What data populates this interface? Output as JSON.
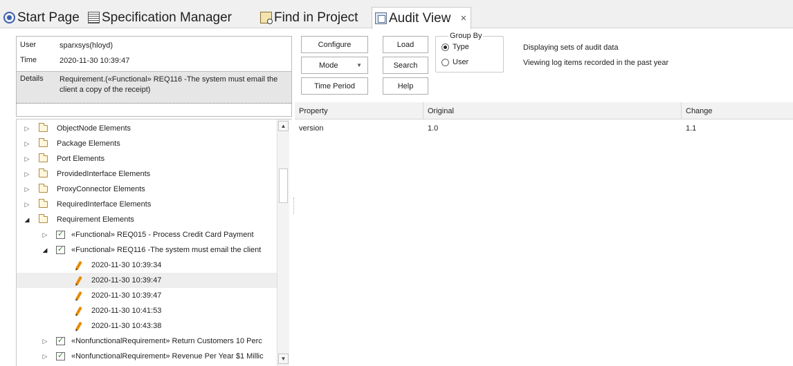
{
  "tabs": [
    {
      "label": "Start Page",
      "icon": "start-page-icon"
    },
    {
      "label": "Specification Manager",
      "icon": "specification-icon"
    },
    {
      "label": "Find in Project",
      "icon": "find-icon"
    },
    {
      "label": "Audit View",
      "icon": "audit-view-icon",
      "active": true,
      "close": "×"
    }
  ],
  "info": {
    "user_label": "User",
    "user_value": "sparxsys(hloyd)",
    "time_label": "Time",
    "time_value": "2020-11-30 10:39:47",
    "details_label": "Details",
    "details_value": "Requirement.(«Functional» REQ116 -The system must email the client a copy of the receipt)"
  },
  "tree": {
    "items": [
      {
        "label": "ObjectNode Elements",
        "expander": "▷",
        "icon": "folder-icon"
      },
      {
        "label": "Package Elements",
        "expander": "▷",
        "icon": "folder-icon"
      },
      {
        "label": "Port Elements",
        "expander": "▷",
        "icon": "folder-icon"
      },
      {
        "label": "ProvidedInterface Elements",
        "expander": "▷",
        "icon": "folder-icon"
      },
      {
        "label": "ProxyConnector Elements",
        "expander": "▷",
        "icon": "folder-icon"
      },
      {
        "label": "RequiredInterface Elements",
        "expander": "▷",
        "icon": "folder-icon"
      },
      {
        "label": "Requirement Elements",
        "expander": "◢",
        "icon": "folder-icon"
      },
      {
        "label": "«Functional» REQ015 - Process Credit Card Payment",
        "expander": "▷",
        "icon": "requirement-icon"
      },
      {
        "label": "«Functional» REQ116 -The system must email the client",
        "expander": "◢",
        "icon": "requirement-icon"
      },
      {
        "label": "2020-11-30 10:39:34",
        "icon": "pencil-icon"
      },
      {
        "label": "2020-11-30 10:39:47",
        "icon": "pencil-icon",
        "selected": true
      },
      {
        "label": "2020-11-30 10:39:47",
        "icon": "pencil-icon"
      },
      {
        "label": "2020-11-30 10:41:53",
        "icon": "pencil-icon"
      },
      {
        "label": "2020-11-30 10:43:38",
        "icon": "pencil-icon"
      },
      {
        "label": "«NonfunctionalRequirement» Return Customers 10 Perc",
        "expander": "▷",
        "icon": "requirement-icon"
      },
      {
        "label": "«NonfunctionalRequirement» Revenue Per Year $1 Millic",
        "expander": "▷",
        "icon": "requirement-icon"
      }
    ]
  },
  "toolbar": {
    "configure": "Configure",
    "load": "Load",
    "mode": "Mode",
    "search": "Search",
    "time_period": "Time Period",
    "help": "Help"
  },
  "group_by": {
    "legend": "Group By",
    "options": [
      {
        "label": "Type",
        "selected": true
      },
      {
        "label": "User",
        "selected": false
      }
    ]
  },
  "status": {
    "line1": "Displaying sets of audit data",
    "line2": "Viewing log items recorded in the past year"
  },
  "grid": {
    "columns": [
      "Property",
      "Original",
      "Change"
    ],
    "rows": [
      [
        "version",
        "1.0",
        "1.1"
      ]
    ]
  }
}
